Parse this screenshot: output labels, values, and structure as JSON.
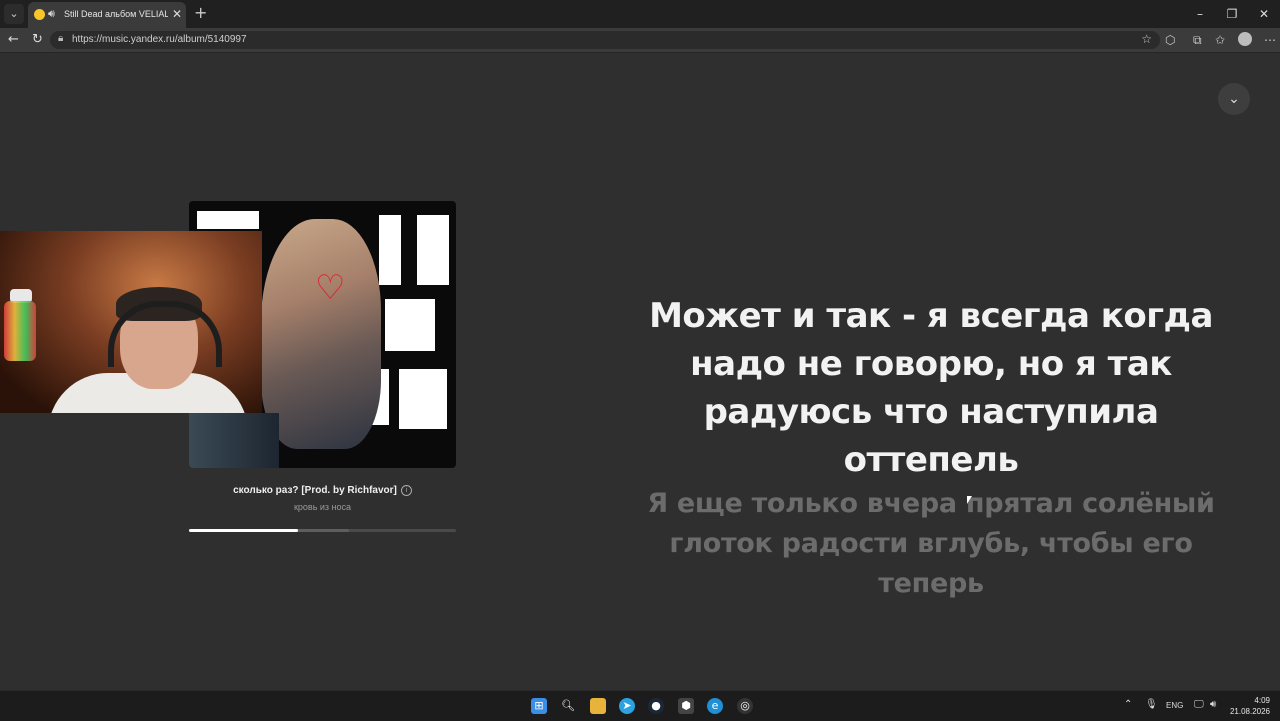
{
  "browser": {
    "tab_title": "Still Dead альбом VELIAL SQUAD",
    "url": "https://music.yandex.ru/album/5140997",
    "icons": {
      "tab_menu": "chevron-down-icon",
      "audio": "speaker-icon",
      "close": "close-icon",
      "new_tab": "plus-icon"
    }
  },
  "player": {
    "track_title": "сколько раз? [Prod. by Richfavor]",
    "artist": "кровь из носа",
    "progress": 0.41,
    "buffered": 0.6
  },
  "lyrics": {
    "active": "Может и так - я всегда когда надо не говорю, но я так радуюсь что наступила оттепель",
    "next": "Я еще только вчера прятал солёный глоток радости вглубь, чтобы его теперь"
  },
  "taskbar": {
    "language": "ENG",
    "time": "4:09",
    "date": "21.08.2026"
  },
  "colors": {
    "page_bg": "#2f2f2f",
    "lyric_active": "#f2f2f2",
    "lyric_next": "#6c6c6c",
    "accent_yellow": "#f7c62b"
  }
}
